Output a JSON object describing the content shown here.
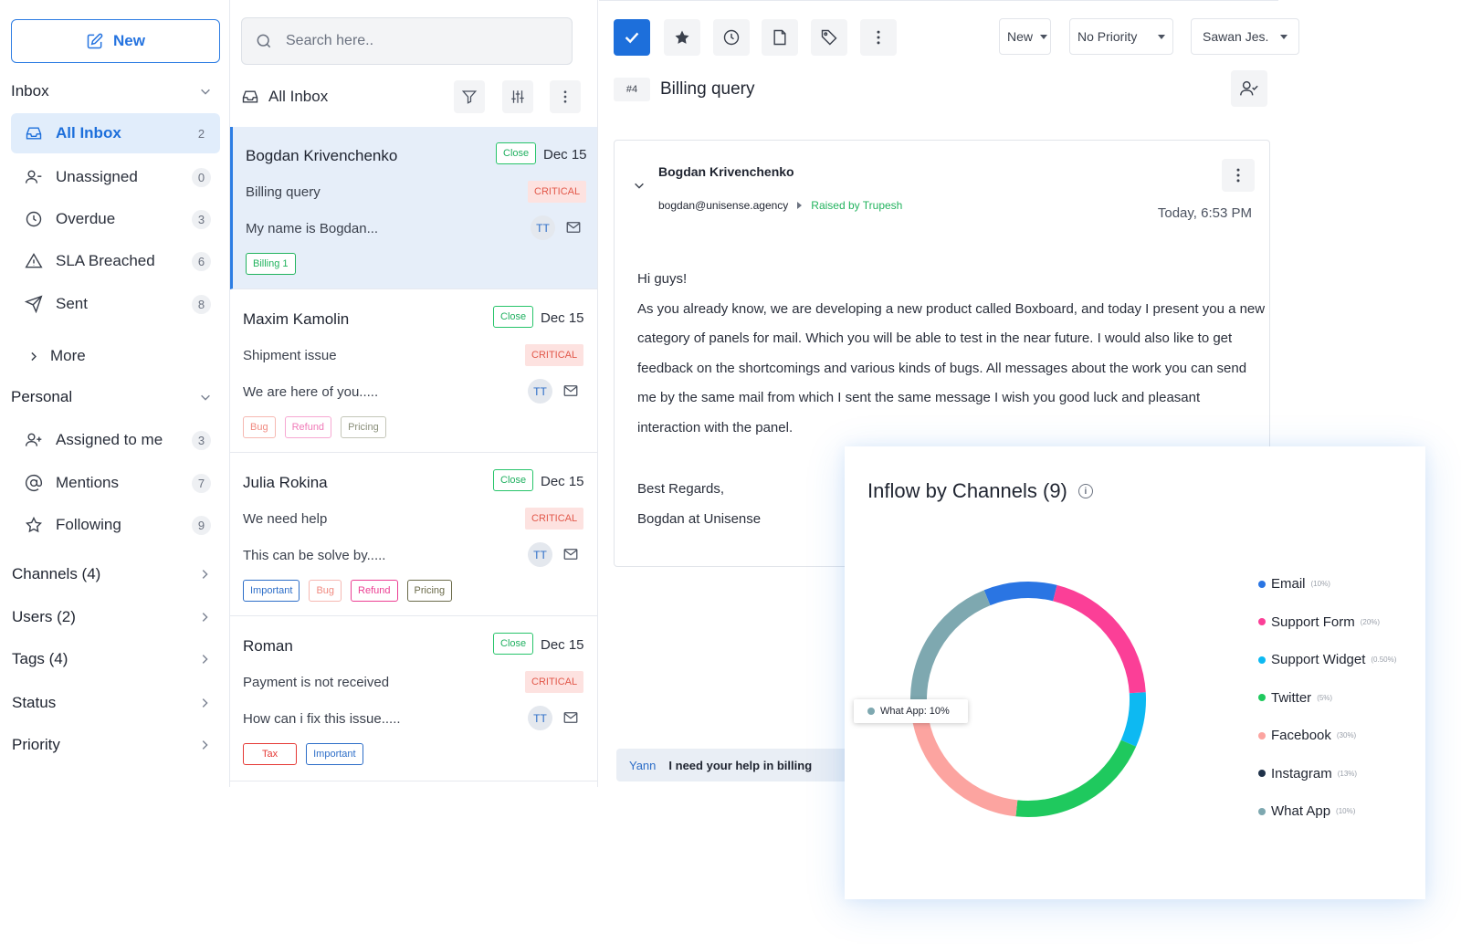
{
  "sidebar": {
    "new_label": "New",
    "inbox_title": "Inbox",
    "inbox_items": [
      {
        "label": "All Inbox",
        "count": "2"
      },
      {
        "label": "Unassigned",
        "count": "0"
      },
      {
        "label": "Overdue",
        "count": "3"
      },
      {
        "label": "SLA Breached",
        "count": "6"
      },
      {
        "label": "Sent",
        "count": "8"
      }
    ],
    "more_label": "More",
    "personal_title": "Personal",
    "personal_items": [
      {
        "label": "Assigned to me",
        "count": "3"
      },
      {
        "label": "Mentions",
        "count": "7"
      },
      {
        "label": "Following",
        "count": "9"
      }
    ],
    "sections": [
      "Channels (4)",
      "Users (2)",
      "Tags (4)",
      "Status",
      "Priority"
    ]
  },
  "list": {
    "search_placeholder": "Search here..",
    "header_title": "All Inbox",
    "cards": [
      {
        "name": "Bogdan Krivenchenko",
        "status": "Close",
        "date": "Dec 15",
        "subject": "Billing query",
        "priority": "CRITICAL",
        "snippet": "My name is Bogdan...",
        "avatar": "TT",
        "tags": [
          {
            "label": "Billing 1",
            "color": "#22b35e"
          }
        ]
      },
      {
        "name": "Maxim Kamolin",
        "status": "Close",
        "date": "Dec 15",
        "subject": "Shipment issue",
        "priority": "CRITICAL",
        "snippet": "We are here of you.....",
        "avatar": "TT",
        "tags": [
          {
            "label": "Bug",
            "color": "#f08a80"
          },
          {
            "label": "Refund",
            "color": "#f07ab8"
          },
          {
            "label": "Pricing",
            "color": "#8a8f7a"
          }
        ]
      },
      {
        "name": "Julia Rokina",
        "status": "Close",
        "date": "Dec 15",
        "subject": "We need help",
        "priority": "CRITICAL",
        "snippet": "This can be solve by.....",
        "avatar": "TT",
        "tags": [
          {
            "label": "Important",
            "color": "#2d6ec8"
          },
          {
            "label": "Bug",
            "color": "#f08a80"
          },
          {
            "label": "Refund",
            "color": "#ec3f93"
          },
          {
            "label": "Pricing",
            "color": "#6b6b4a"
          }
        ]
      },
      {
        "name": "Roman",
        "status": "Close",
        "date": "Dec 15",
        "subject": "Payment is not received",
        "priority": "CRITICAL",
        "snippet": "How can i fix this issue.....",
        "avatar": "TT",
        "tags": [
          {
            "label": "Tax",
            "color": "#e53935"
          },
          {
            "label": "Important",
            "color": "#2d6ec8"
          }
        ]
      }
    ]
  },
  "toolbar": {
    "status_value": "New",
    "priority_value": "No Priority",
    "assignee_value": "Sawan Jes."
  },
  "ticket": {
    "id": "#4",
    "title": "Billing query",
    "from_name": "Bogdan Krivenchenko",
    "from_email": "bogdan@unisense.agency",
    "raised_by": "Raised by Trupesh",
    "time": "Today, 6:53 PM",
    "body_lines": [
      "Hi guys!",
      "As you already know, we are developing a new product called Boxboard, and today I present you a new",
      "category of panels for mail. Which you will be able to test in the near future. I would also like to get",
      "feedback on the shortcomings and various kinds of bugs. All messages about the work you can send",
      "me by the same mail from which I sent the same message I wish you good luck and pleasant",
      "interaction with the panel."
    ],
    "sig_lines": [
      "Best Regards,",
      "Bogdan at Unisense"
    ]
  },
  "reply": {
    "who": "Yann",
    "text": "I need your help in billing"
  },
  "colors": {
    "accent": "#1d6fdb",
    "success": "#22b35e",
    "critical": "#e2584a"
  },
  "chart_data": {
    "type": "pie",
    "title": "Inflow by Channels (9)",
    "tooltip": "What App: 10%",
    "series": [
      {
        "name": "Email",
        "label": "(10%)",
        "value": 10,
        "color": "#2a75e3"
      },
      {
        "name": "Support Form",
        "label": "(20%)",
        "value": 20,
        "color": "#fb3f97"
      },
      {
        "name": "Support Widget",
        "label": "(0.50%)",
        "value": 7.5,
        "color": "#0db9f2"
      },
      {
        "name": "Twitter",
        "label": "(5%)",
        "value": 20,
        "color": "#1fc95e"
      },
      {
        "name": "Facebook",
        "label": "(30%)",
        "value": 20,
        "color": "#fca4a0"
      },
      {
        "name": "Instagram",
        "label": "(13%)",
        "value": 0.5,
        "color": "#20324a"
      },
      {
        "name": "What App",
        "label": "(10%)",
        "value": 21.5,
        "color": "#7ea8b0"
      }
    ]
  }
}
